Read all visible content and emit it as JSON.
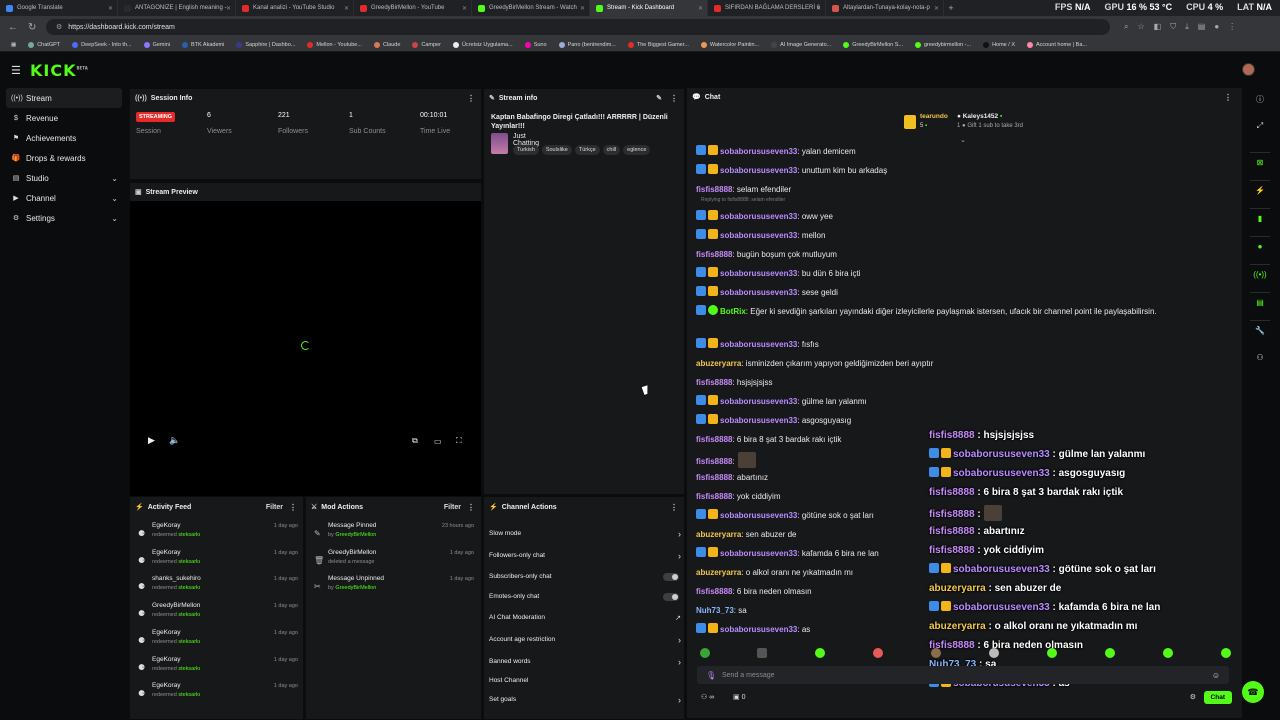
{
  "browser": {
    "tabs": [
      {
        "title": "Google Translate",
        "color": "#4285f4"
      },
      {
        "title": "ANTAGONIZE | English meaning -",
        "color": "#2a2a2a"
      },
      {
        "title": "Kanal analizi - YouTube Studio",
        "color": "#e52a2a"
      },
      {
        "title": "GreedyBirMellon - YouTube",
        "color": "#e52a2a"
      },
      {
        "title": "GreedyBirMellon Stream - Watch",
        "color": "#53fc18"
      },
      {
        "title": "Stream - Kick Dashboard",
        "color": "#53fc18",
        "active": true
      },
      {
        "title": "SIFIRDAN BAĞLAMA DERSLERİ 6",
        "color": "#e52a2a"
      },
      {
        "title": "Altaylardan-Tunaya-kolay-nota-p",
        "color": "#d9534f"
      }
    ],
    "new_tab": "+",
    "url": "https://dashboard.kick.com/stream",
    "hud": {
      "fps_label": "FPS",
      "fps": "N/A",
      "gpu_label": "GPU",
      "gpu": "16 % 53 °C",
      "cpu_label": "CPU",
      "cpu": "4 %",
      "lat_label": "LAT",
      "lat": "N/A"
    },
    "bookmarks": [
      "ChatGPT",
      "DeepSeek - Into th...",
      "Gemini",
      "BTK Akademi",
      "Sapphire | Dashbo...",
      "Mellon - Youtube...",
      "Claude",
      "Camper",
      "Ücretsiz Uygulama...",
      "Suno",
      "Pano (bentrendim...",
      "The Biggest Gamer...",
      "Watercolor Paintin...",
      "AI Image Generato...",
      "GreedyBirMellon S...",
      "greedybirmellon -...",
      "Home / X",
      "Account home | Ba..."
    ]
  },
  "app": {
    "logo": "KICK",
    "logo_sup": "BETA",
    "sidebar": [
      {
        "label": "Stream",
        "active": true,
        "chev": false
      },
      {
        "label": "Revenue",
        "chev": false
      },
      {
        "label": "Achievements",
        "chev": false
      },
      {
        "label": "Drops & rewards",
        "chev": false
      },
      {
        "label": "Studio",
        "chev": true
      },
      {
        "label": "Channel",
        "chev": true
      },
      {
        "label": "Settings",
        "chev": true
      }
    ],
    "session": {
      "title": "Session Info",
      "badge": "STREAMING",
      "session_label": "Session",
      "viewers": "6",
      "viewers_label": "Viewers",
      "followers": "221",
      "followers_label": "Followers",
      "subs": "1",
      "subs_label": "Sub Counts",
      "time": "00:10:01",
      "time_label": "Time Live"
    },
    "preview": {
      "title": "Stream Preview"
    },
    "stream_info": {
      "title": "Stream info",
      "stream_title": "Kaptan Babafingo Diregi Çatladı!!! ARRRRR | Düzenli Yayınlar!!!",
      "category": "Just Chatting",
      "tags": [
        "Turkish",
        "Soulslike",
        "Türkçe",
        "chill",
        "eglence"
      ]
    },
    "activity": {
      "title": "Activity Feed",
      "filter": "Filter",
      "items": [
        {
          "name": "EgeKoray",
          "action": "redeemed",
          "reward": "steksarkı",
          "time": "1 day ago"
        },
        {
          "name": "EgeKoray",
          "action": "redeemed",
          "reward": "steksarkı",
          "time": "1 day ago"
        },
        {
          "name": "shanks_sukehiro",
          "action": "redeemed",
          "reward": "steksarkı",
          "time": "1 day ago"
        },
        {
          "name": "GreedyBirMellon",
          "action": "redeemed",
          "reward": "steksarkı",
          "time": "1 day ago"
        },
        {
          "name": "EgeKoray",
          "action": "redeemed",
          "reward": "steksarkı",
          "time": "1 day ago"
        },
        {
          "name": "EgeKoray",
          "action": "redeemed",
          "reward": "steksarkı",
          "time": "1 day ago"
        },
        {
          "name": "EgeKoray",
          "action": "redeemed",
          "reward": "steksarkı",
          "time": "1 day ago"
        }
      ]
    },
    "mod": {
      "title": "Mod Actions",
      "filter": "Filter",
      "items": [
        {
          "name": "Message Pinned",
          "sub": "by",
          "by": "GreedyBirMellon",
          "time": "23 hours ago",
          "icon": "📌"
        },
        {
          "name": "GreedyBirMellon",
          "sub": "deleted a message",
          "by": "",
          "time": "1 day ago",
          "icon": "🗑"
        },
        {
          "name": "Message Unpinned",
          "sub": "by",
          "by": "GreedyBirMellon",
          "time": "1 day ago",
          "icon": "✂"
        }
      ]
    },
    "channel_actions": {
      "title": "Channel Actions",
      "items": [
        {
          "label": "Slow mode",
          "kind": "chev"
        },
        {
          "label": "Followers-only chat",
          "kind": "chev"
        },
        {
          "label": "Subscribers-only chat",
          "kind": "toggle"
        },
        {
          "label": "Emotes-only chat",
          "kind": "toggle"
        },
        {
          "label": "AI Chat Moderation",
          "kind": "ext"
        },
        {
          "label": "Account age restriction",
          "kind": "chev"
        },
        {
          "label": "Banned words",
          "kind": "chev"
        },
        {
          "label": "Host Channel",
          "kind": "none"
        },
        {
          "label": "Set goals",
          "kind": "chev"
        }
      ]
    },
    "chat": {
      "title": "Chat",
      "pinned_user1": "tearundo",
      "pinned_count1": "5",
      "pinned_user2": "Kaleys1452",
      "pinned_count2": "1",
      "pinned_note": "Gift 1 sub to take 3rd",
      "messages": [
        {
          "user": "sobaborususeven33",
          "text": ": yalan demicem",
          "color": "#b98cff",
          "badges": true
        },
        {
          "user": "sobaborususeven33",
          "text": ": unuttum kim bu arkadaş",
          "color": "#b98cff",
          "badges": true
        },
        {
          "user": "fisfis8888",
          "text": ": selam efendiler",
          "color": "#c58af9",
          "badges": false
        },
        {
          "reply": "Replying to fisfis8888: selam efendiler"
        },
        {
          "user": "sobaborususeven33",
          "text": ": oww yee",
          "color": "#b98cff",
          "badges": true
        },
        {
          "user": "sobaborususeven33",
          "text": ": mellon",
          "color": "#b98cff",
          "badges": true
        },
        {
          "user": "fisfis8888",
          "text": ": bugün boşum çok mutluyum",
          "color": "#c58af9",
          "badges": false
        },
        {
          "user": "sobaborususeven33",
          "text": ": bu dün 6 bira içti",
          "color": "#b98cff",
          "badges": true
        },
        {
          "user": "sobaborususeven33",
          "text": ": sese geldi",
          "color": "#b98cff",
          "badges": true
        },
        {
          "user": "BotRix",
          "text": ": Eğer ki sevdiğin şarkıları yayındaki diğer izleyicilerle paylaşmak istersen, ufacık bir channel point ile paylaşabilirsin.",
          "color": "#53fc18",
          "badges": true,
          "bot": true
        },
        {
          "user": "sobaborususeven33",
          "text": ": fısfıs",
          "color": "#b98cff",
          "badges": true
        },
        {
          "user": "abuzeryarra",
          "text": ": isminizden çıkarım yapıyon geldiğimizden beri ayıptır",
          "color": "#f2c94c",
          "badges": false
        },
        {
          "user": "fisfis8888",
          "text": ": hsjsjsjsjss",
          "color": "#c58af9",
          "badges": false
        },
        {
          "user": "sobaborususeven33",
          "text": ": gülme lan yalanmı",
          "color": "#b98cff",
          "badges": true
        },
        {
          "user": "sobaborususeven33",
          "text": ": asgosguyasıg",
          "color": "#b98cff",
          "badges": true
        },
        {
          "user": "fisfis8888",
          "text": ": 6 bira 8 şat 3 bardak rakı içtik",
          "color": "#c58af9",
          "badges": false
        },
        {
          "user": "fisfis8888",
          "text": ":",
          "color": "#c58af9",
          "badges": false,
          "emote": true
        },
        {
          "user": "fisfis8888",
          "text": ": abartınız",
          "color": "#c58af9",
          "badges": false
        },
        {
          "user": "fisfis8888",
          "text": ": yok ciddiyim",
          "color": "#c58af9",
          "badges": false
        },
        {
          "user": "sobaborususeven33",
          "text": ": götüne sok o şat ları",
          "color": "#b98cff",
          "badges": true
        },
        {
          "user": "abuzeryarra",
          "text": ": sen abuzer de",
          "color": "#f2c94c",
          "badges": false
        },
        {
          "user": "sobaborususeven33",
          "text": ": kafamda 6 bira ne lan",
          "color": "#b98cff",
          "badges": true
        },
        {
          "user": "abuzeryarra",
          "text": ": o alkol oranı ne yıkatmadın mı",
          "color": "#f2c94c",
          "badges": false
        },
        {
          "user": "fisfis8888",
          "text": ": 6 bira neden olmasın",
          "color": "#c58af9",
          "badges": false
        },
        {
          "user": "Nuh73_73",
          "text": ": sa",
          "color": "#8ab4f8",
          "badges": false
        },
        {
          "user": "sobaborususeven33",
          "text": ": as",
          "color": "#b98cff",
          "badges": true
        }
      ],
      "overlay": [
        {
          "user": "fisfis8888",
          "text": " : hsjsjsjsjss",
          "color": "#c58af9",
          "badges": false
        },
        {
          "user": "sobaborususeven33",
          "text": " : gülme lan yalanmı",
          "color": "#b98cff",
          "badges": true
        },
        {
          "user": "sobaborususeven33",
          "text": " : asgosguyasıg",
          "color": "#b98cff",
          "badges": true
        },
        {
          "user": "fisfis8888",
          "text": " : 6 bira 8 şat 3 bardak rakı içtik",
          "color": "#c58af9",
          "badges": false
        },
        {
          "user": "fisfis8888",
          "text": " :",
          "color": "#c58af9",
          "badges": false,
          "emote": true
        },
        {
          "user": "fisfis8888",
          "text": " : abartınız",
          "color": "#c58af9",
          "badges": false
        },
        {
          "user": "fisfis8888",
          "text": " : yok ciddiyim",
          "color": "#c58af9",
          "badges": false
        },
        {
          "user": "sobaborususeven33",
          "text": " : götüne sok o şat ları",
          "color": "#b98cff",
          "badges": true
        },
        {
          "user": "abuzeryarra",
          "text": " : sen abuzer de",
          "color": "#f2c94c",
          "badges": false
        },
        {
          "user": "sobaborususeven33",
          "text": " : kafamda 6 bira ne lan",
          "color": "#b98cff",
          "badges": true
        },
        {
          "user": "abuzeryarra",
          "text": " : o alkol oranı ne yıkatmadın mı",
          "color": "#f2c94c",
          "badges": false
        },
        {
          "user": "fisfis8888",
          "text": " : 6 bira neden olmasın",
          "color": "#c58af9",
          "badges": false
        },
        {
          "user": "Nuh73_73",
          "text": " : sa",
          "color": "#8ab4f8",
          "badges": false
        },
        {
          "user": "sobaborususeven33",
          "text": " : as",
          "color": "#b98cff",
          "badges": true
        }
      ],
      "input_placeholder": "Send a message",
      "viewer_count": "∞",
      "points": "0",
      "send_label": "Chat"
    }
  }
}
